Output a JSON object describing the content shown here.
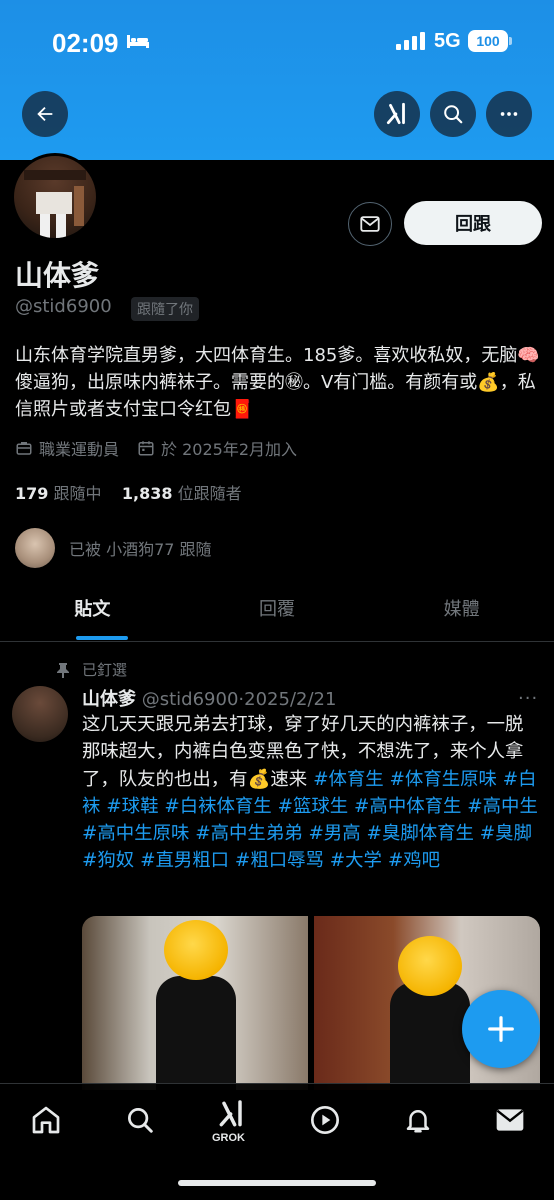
{
  "status_bar": {
    "time": "02:09",
    "network": "5G",
    "battery": "100"
  },
  "icons": {
    "back": "arrow-left-icon",
    "grok": "grok-icon",
    "search": "search-icon",
    "more": "more-horizontal-icon",
    "message": "envelope-icon",
    "pin": "pin-icon",
    "compose": "plus-icon"
  },
  "profile": {
    "display_name": "山体爹",
    "handle": "@stid6900",
    "follows_you": "跟隨了你",
    "bio": "山东体育学院直男爹，大四体育生。185爹。喜欢收私奴，无脑🧠傻逼狗，出原味内裤袜子。需要的㊙。V有门槛。有颜有或💰，私信照片或者支付宝口令红包🧧",
    "profession": "職業運動員",
    "joined": "於 2025年2月加入",
    "following_count": "179",
    "following_label": "跟隨中",
    "followers_count": "1,838",
    "followers_label": "位跟隨者",
    "followed_by": "已被 小酒狗77 跟隨",
    "follow_back_label": "回跟"
  },
  "tabs": [
    {
      "label": "貼文",
      "active": true
    },
    {
      "label": "回覆",
      "active": false
    },
    {
      "label": "媒體",
      "active": false
    }
  ],
  "post": {
    "pinned_label": "已釘選",
    "author_name": "山体爹",
    "author_handle": "@stid6900",
    "date_sep": "·",
    "date": "2025/2/21",
    "more": "···",
    "text": "这几天天跟兄弟去打球，穿了好几天的内裤袜子，一脱那味超大，内裤白色变黑色了快，不想洗了，来个人拿了，队友的也出，有💰速来",
    "hashtags": [
      "#体育生",
      "#体育生原味",
      "#白袜",
      "#球鞋",
      "#白袜体育生",
      "#篮球生",
      "#高中体育生",
      "#高中生",
      "#高中生原味",
      "#高中生弟弟",
      "#男高",
      "#臭脚体育生",
      "#臭脚",
      "#狗奴",
      "#直男粗口",
      "#粗口辱骂",
      "#大学",
      "#鸡吧"
    ]
  },
  "bottom_nav": {
    "grok_label": "GROK",
    "items": [
      "home-icon",
      "search-icon",
      "grok-icon",
      "play-icon",
      "bell-icon",
      "mail-icon"
    ]
  },
  "colors": {
    "banner": "#1d9bf0",
    "accent": "#1d9bf0",
    "background": "#000000",
    "text": "#e7e9ea",
    "secondary_text": "#71767b"
  }
}
